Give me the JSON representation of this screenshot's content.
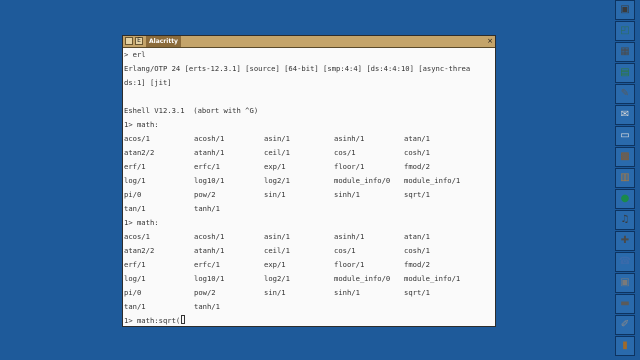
{
  "window": {
    "buttons": [
      "",
      "E"
    ],
    "title": "Alacritty",
    "close_label": "×"
  },
  "terminal": {
    "lines_before": [
      "> erl",
      "Erlang/OTP 24 [erts-12.3.1] [source] [64-bit] [smp:4:4] [ds:4:4:10] [async-threa",
      "ds:1] [jit]",
      "",
      "Eshell V12.3.1  (abort with ^G)",
      "1> math:"
    ],
    "block1": [
      [
        "acos/1",
        "acosh/1",
        "asin/1",
        "asinh/1",
        "atan/1"
      ],
      [
        "atan2/2",
        "atanh/1",
        "ceil/1",
        "cos/1",
        "cosh/1"
      ],
      [
        "erf/1",
        "erfc/1",
        "exp/1",
        "floor/1",
        "fmod/2"
      ],
      [
        "log/1",
        "log10/1",
        "log2/1",
        "module_info/0",
        "module_info/1"
      ],
      [
        "pi/0",
        "pow/2",
        "sin/1",
        "sinh/1",
        "sqrt/1"
      ],
      [
        "tan/1",
        "tanh/1",
        "",
        "",
        ""
      ]
    ],
    "prompt2": "1> math:",
    "block2": [
      [
        "acos/1",
        "acosh/1",
        "asin/1",
        "asinh/1",
        "atan/1"
      ],
      [
        "atan2/2",
        "atanh/1",
        "ceil/1",
        "cos/1",
        "cosh/1"
      ],
      [
        "erf/1",
        "erfc/1",
        "exp/1",
        "floor/1",
        "fmod/2"
      ],
      [
        "log/1",
        "log10/1",
        "log2/1",
        "module_info/0",
        "module_info/1"
      ],
      [
        "pi/0",
        "pow/2",
        "sin/1",
        "sinh/1",
        "sqrt/1"
      ],
      [
        "tan/1",
        "tanh/1",
        "",
        "",
        ""
      ]
    ],
    "current_input": "1> math:sqrt("
  },
  "dock": {
    "items": [
      {
        "name": "terminal-icon",
        "glyph": "▣",
        "color": "#3a3a3a"
      },
      {
        "name": "window-maker-icon",
        "glyph": "◰",
        "color": "#2c6e5a"
      },
      {
        "name": "calculator-icon",
        "glyph": "▦",
        "color": "#4a4a4a"
      },
      {
        "name": "desktop-icon",
        "glyph": "▤",
        "color": "#2e7a3a"
      },
      {
        "name": "paint-icon",
        "glyph": "✎",
        "color": "#5a5a5a"
      },
      {
        "name": "mail-icon",
        "glyph": "✉",
        "color": "#d8d8d8"
      },
      {
        "name": "notes-icon",
        "glyph": "▭",
        "color": "#e0e0e0"
      },
      {
        "name": "package-icon",
        "glyph": "▩",
        "color": "#8a5a2a"
      },
      {
        "name": "file-manager-icon",
        "glyph": "▥",
        "color": "#b07a3a"
      },
      {
        "name": "globe-icon",
        "glyph": "●",
        "color": "#1a8a4a"
      },
      {
        "name": "audio-mixer-icon",
        "glyph": "♫",
        "color": "#3a3a3a"
      },
      {
        "name": "joystick-icon",
        "glyph": "✚",
        "color": "#4a4a4a"
      },
      {
        "name": "phone-icon",
        "glyph": "☎",
        "color": "#3a6aaa"
      },
      {
        "name": "printer-icon",
        "glyph": "▣",
        "color": "#7a7a7a"
      },
      {
        "name": "drive-icon",
        "glyph": "▬",
        "color": "#5a5a5a"
      },
      {
        "name": "tool-icon",
        "glyph": "✐",
        "color": "#8a8a8a"
      },
      {
        "name": "trash-icon",
        "glyph": "▮",
        "color": "#a06a2a"
      }
    ]
  }
}
